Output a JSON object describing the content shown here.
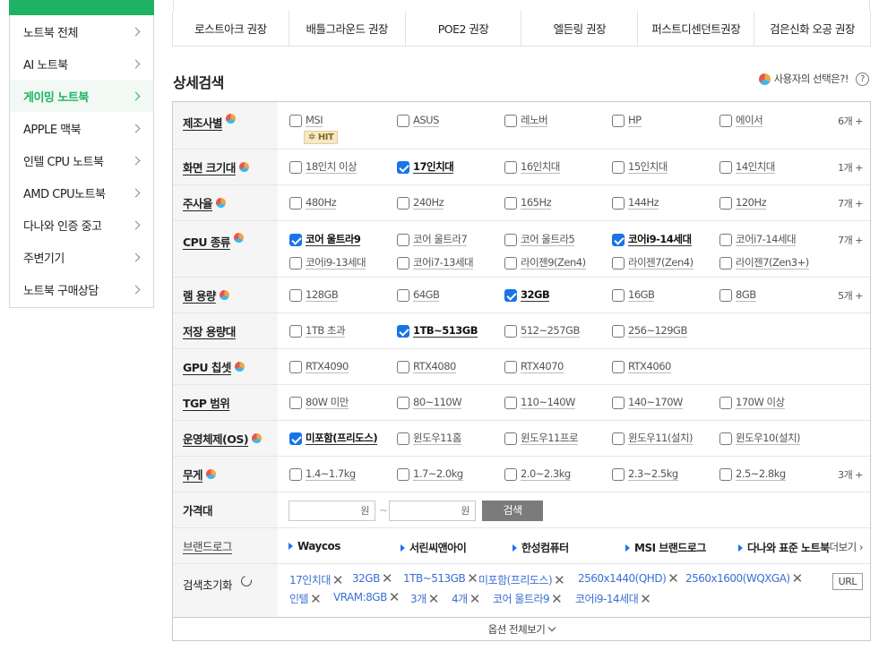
{
  "sidebar": {
    "items": [
      {
        "label": "노트북 전체"
      },
      {
        "label": "AI 노트북"
      },
      {
        "label": "게이밍 노트북",
        "active": true
      },
      {
        "label": "APPLE 맥북"
      },
      {
        "label": "인텔 CPU 노트북"
      },
      {
        "label": "AMD CPU노트북"
      },
      {
        "label": "다나와 인증 중고"
      },
      {
        "label": "주변기기"
      },
      {
        "label": "노트북 구매상담"
      }
    ]
  },
  "tags": [
    "로스트아크 권장",
    "배틀그라운드 권장",
    "POE2 권장",
    "엘든링 권장",
    "퍼스트디센던트권장",
    "검은신화 오공 권장"
  ],
  "header": {
    "title": "상세검색",
    "user_choice": "사용자의 선택은?!",
    "help": "?"
  },
  "filters": [
    {
      "label": "제조사별",
      "dot": true,
      "more": "6개 +",
      "hit": "HIT",
      "options": [
        [
          "MSI",
          false
        ],
        [
          "ASUS",
          false
        ],
        [
          "레노버",
          false
        ],
        [
          "HP",
          false
        ],
        [
          "에이서",
          false
        ]
      ]
    },
    {
      "label": "화면 크기대",
      "dot": true,
      "more": "1개 +",
      "options": [
        [
          "18인치 이상",
          false
        ],
        [
          "17인치대",
          true
        ],
        [
          "16인치대",
          false
        ],
        [
          "15인치대",
          false
        ],
        [
          "14인치대",
          false
        ]
      ]
    },
    {
      "label": "주사율",
      "dot": true,
      "more": "7개 +",
      "options": [
        [
          "480Hz",
          false
        ],
        [
          "240Hz",
          false
        ],
        [
          "165Hz",
          false
        ],
        [
          "144Hz",
          false
        ],
        [
          "120Hz",
          false
        ]
      ]
    },
    {
      "label": "CPU 종류",
      "dot": true,
      "more": "7개 +",
      "options": [
        [
          "코어 울트라9",
          true
        ],
        [
          "코어 울트라7",
          false
        ],
        [
          "코어 울트라5",
          false
        ],
        [
          "코어i9-14세대",
          true
        ],
        [
          "코어i7-14세대",
          false
        ],
        [
          "코어i9-13세대",
          false
        ],
        [
          "코어i7-13세대",
          false
        ],
        [
          "라이젠9(Zen4)",
          false
        ],
        [
          "라이젠7(Zen4)",
          false
        ],
        [
          "라이젠7(Zen3+)",
          false
        ]
      ]
    },
    {
      "label": "램 용량",
      "dot": true,
      "more": "5개 +",
      "options": [
        [
          "128GB",
          false
        ],
        [
          "64GB",
          false
        ],
        [
          "32GB",
          true
        ],
        [
          "16GB",
          false
        ],
        [
          "8GB",
          false
        ]
      ]
    },
    {
      "label": "저장 용량대",
      "dot": false,
      "more": "",
      "options": [
        [
          "1TB 초과",
          false
        ],
        [
          "1TB~513GB",
          true
        ],
        [
          "512~257GB",
          false
        ],
        [
          "256~129GB",
          false
        ]
      ]
    },
    {
      "label": "GPU 칩셋",
      "dot": true,
      "more": "",
      "options": [
        [
          "RTX4090",
          false
        ],
        [
          "RTX4080",
          false
        ],
        [
          "RTX4070",
          false
        ],
        [
          "RTX4060",
          false
        ]
      ]
    },
    {
      "label": "TGP 범위",
      "dot": false,
      "more": "",
      "options": [
        [
          "80W 미만",
          false
        ],
        [
          "80~110W",
          false
        ],
        [
          "110~140W",
          false
        ],
        [
          "140~170W",
          false
        ],
        [
          "170W 이상",
          false
        ]
      ]
    },
    {
      "label": "운영체제(OS)",
      "dot": true,
      "more": "",
      "options": [
        [
          "미포함(프리도스)",
          true
        ],
        [
          "윈도우11홈",
          false
        ],
        [
          "윈도우11프로",
          false
        ],
        [
          "윈도우11(설치)",
          false
        ],
        [
          "윈도우10(설치)",
          false
        ]
      ]
    },
    {
      "label": "무게",
      "dot": true,
      "more": "3개 +",
      "options": [
        [
          "1.4~1.7kg",
          false
        ],
        [
          "1.7~2.0kg",
          false
        ],
        [
          "2.0~2.3kg",
          false
        ],
        [
          "2.3~2.5kg",
          false
        ],
        [
          "2.5~2.8kg",
          false
        ]
      ]
    }
  ],
  "price": {
    "label": "가격대",
    "unit": "원",
    "tilde": "~",
    "search": "검색"
  },
  "brandlog": {
    "label": "브랜드로그",
    "brands": [
      "Waycos",
      "서린씨앤아이",
      "한성컴퓨터",
      "MSI 브랜드로그",
      "다나와 표준 노트북"
    ],
    "more": "더보기 ›"
  },
  "reset": {
    "label": "검색초기화",
    "chips": [
      "17인치대",
      "32GB",
      "1TB~513GB",
      "미포함(프리도스)",
      "2560x1440(QHD)",
      "2560x1600(WQXGA)",
      "인텔",
      "VRAM:8GB",
      "3개",
      "4개",
      "코어 울트라9",
      "코어i9-14세대"
    ],
    "url": "URL"
  },
  "expand": "옵션 전체보기"
}
